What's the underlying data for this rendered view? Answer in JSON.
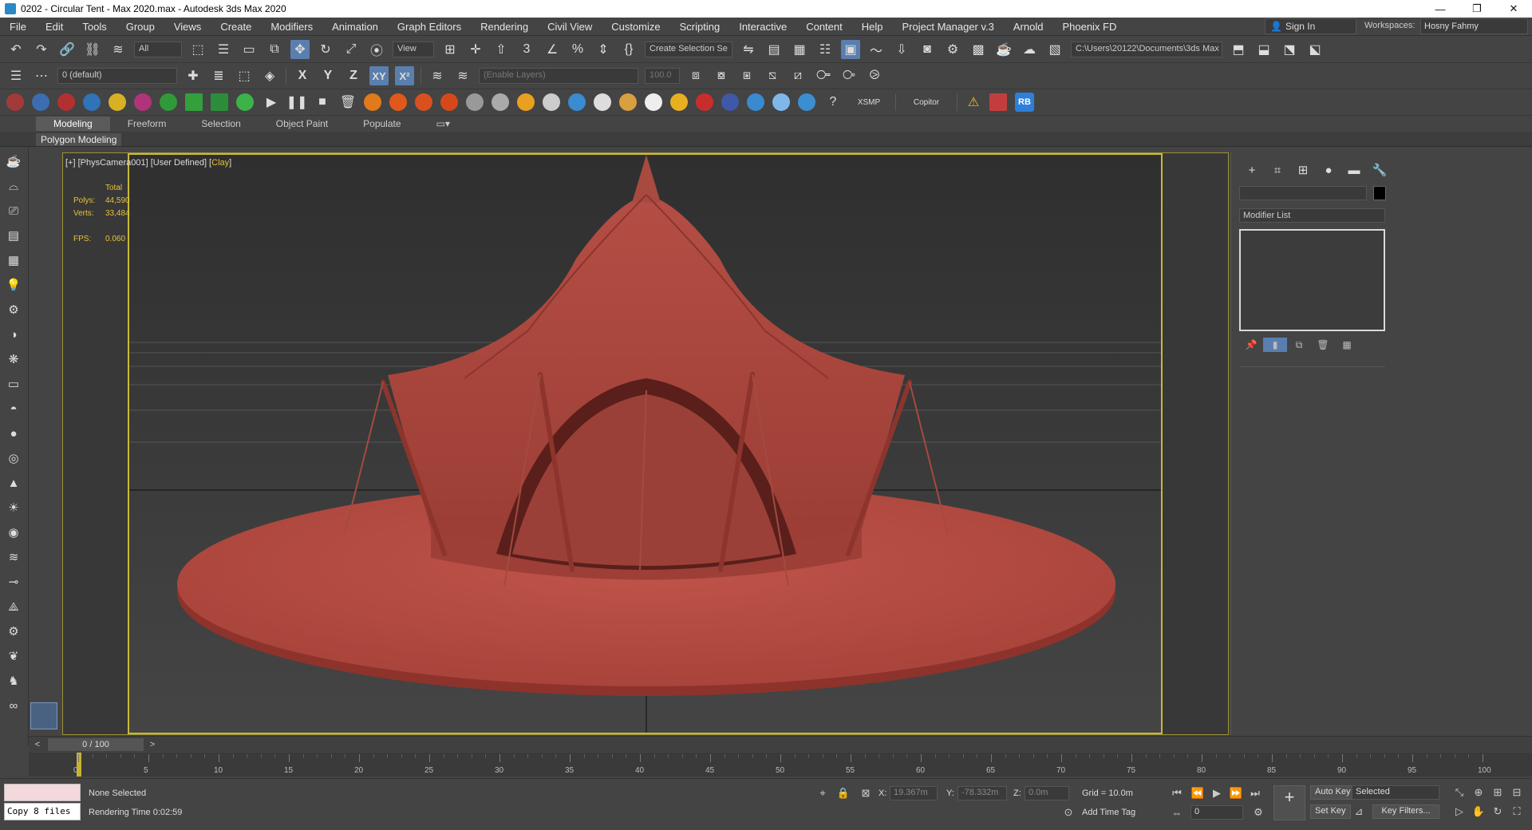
{
  "window": {
    "title": "0202 - Circular Tent - Max 2020.max - Autodesk 3ds Max 2020",
    "minimize": "—",
    "maximize": "❐",
    "close": "✕"
  },
  "menu": {
    "items": [
      "File",
      "Edit",
      "Tools",
      "Group",
      "Views",
      "Create",
      "Modifiers",
      "Animation",
      "Graph Editors",
      "Rendering",
      "Civil View",
      "Customize",
      "Scripting",
      "Interactive",
      "Content",
      "Help",
      "Project Manager v.3",
      "Arnold",
      "Phoenix FD"
    ],
    "sign_in": "Sign In",
    "workspaces_label": "Workspaces:",
    "workspace": "Hosny Fahmy"
  },
  "toolbar1": {
    "selection_filter": "All",
    "ref_coord": "View",
    "named_selection": "Create Selection Se",
    "project_path": "C:\\Users\\20122\\Documents\\3ds Max 2020"
  },
  "toolbar2": {
    "layer": "0 (default)",
    "axis_x": "X",
    "axis_y": "Y",
    "axis_z": "Z",
    "axis_xy": "XY",
    "axis_xz": "X²",
    "enable_layers": "(Enable Layers)",
    "percent": "100.0"
  },
  "toolbar3": {
    "xsmp": "XSMP",
    "copitor": "Copitor",
    "rb": "RB"
  },
  "ribbon": {
    "tabs": [
      "Modeling",
      "Freeform",
      "Selection",
      "Object Paint",
      "Populate"
    ],
    "panel_label": "Polygon Modeling"
  },
  "viewport": {
    "label_prefix": "[+] [PhysCamera001] [User Defined] [",
    "label_shading": "Clay",
    "label_suffix": "]",
    "stats_header": "Total",
    "polys_label": "Polys:",
    "polys": "44,590",
    "verts_label": "Verts:",
    "verts": "33,484",
    "fps_label": "FPS:",
    "fps": "0.060",
    "model_color": "#b0493f"
  },
  "command_panel": {
    "modifier_list": "Modifier List"
  },
  "timeline": {
    "frame": "0 / 100",
    "ticks": [
      0,
      5,
      10,
      15,
      20,
      25,
      30,
      35,
      40,
      45,
      50,
      55,
      60,
      65,
      70,
      75,
      80,
      85,
      90,
      95,
      100
    ]
  },
  "status": {
    "copy_text": "Copy 8 files",
    "selection": "None Selected",
    "render_time": "Rendering Time  0:02:59",
    "x_label": "X:",
    "x_value": "19.367m",
    "y_label": "Y:",
    "y_value": "-78.332m",
    "z_label": "Z:",
    "z_value": "0.0m",
    "grid": "Grid = 10.0m",
    "add_time_tag": "Add Time Tag",
    "auto_key": "Auto Key",
    "key_mode": "Selected",
    "set_key": "Set Key",
    "key_filters": "Key Filters...",
    "current_frame": "0"
  }
}
